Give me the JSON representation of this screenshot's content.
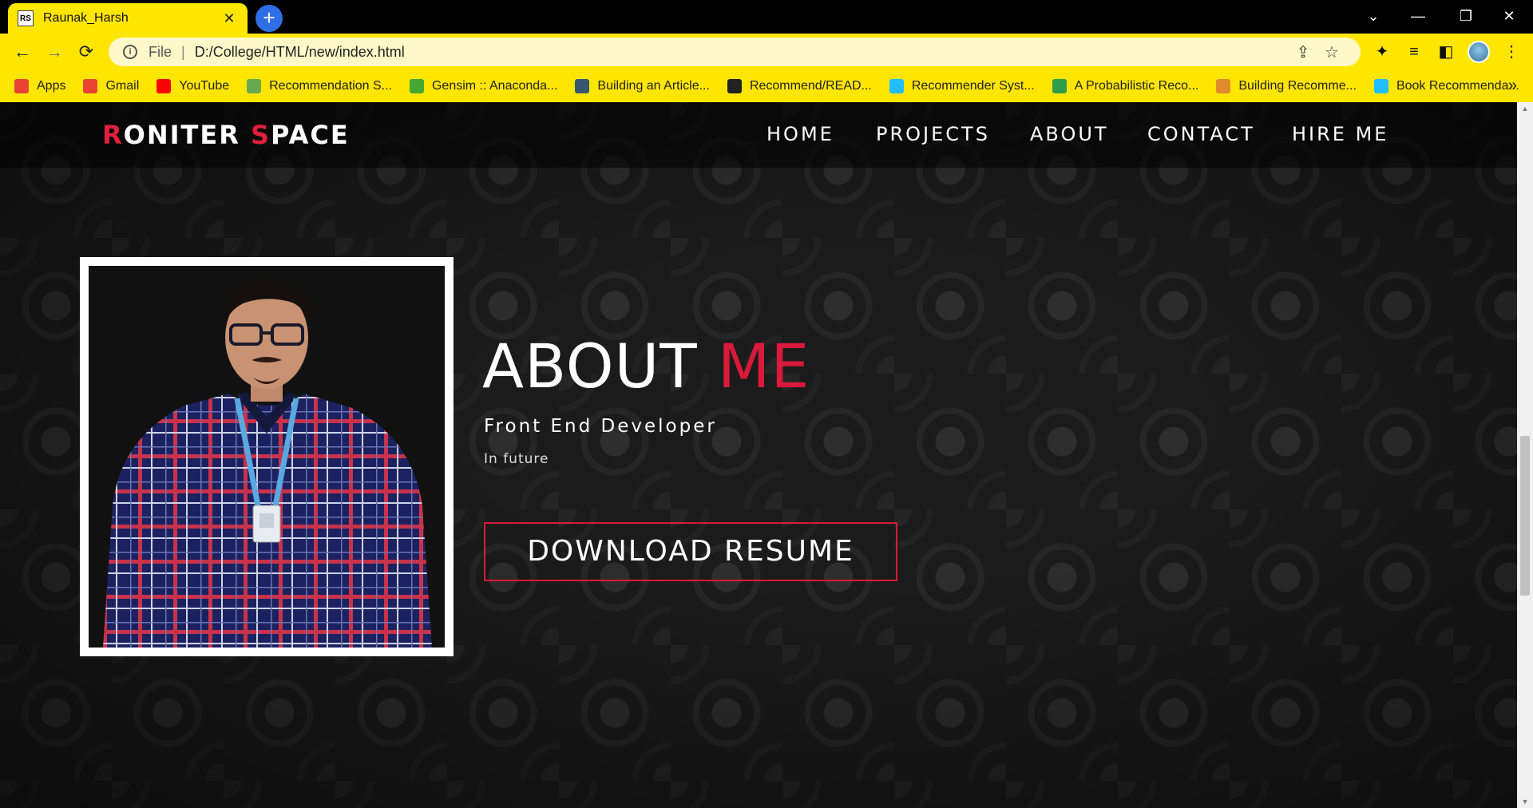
{
  "browser": {
    "tab": {
      "favicon_text": "RS",
      "title": "Raunak_Harsh",
      "close_glyph": "✕"
    },
    "new_tab_glyph": "+",
    "window_controls": {
      "list": "⌄",
      "minimize": "—",
      "restore": "❐",
      "close": "✕"
    },
    "nav": {
      "back": "←",
      "forward": "→",
      "reload": "⟳"
    },
    "address": {
      "info_glyph": "i",
      "scheme": "File",
      "url": "D:/College/HTML/new/index.html"
    },
    "bookmarks": [
      {
        "label": "Apps",
        "icon": "apps-grid-icon",
        "color": "#e94235"
      },
      {
        "label": "Gmail",
        "icon": "gmail-icon",
        "color": "#ea4335"
      },
      {
        "label": "YouTube",
        "icon": "youtube-icon",
        "color": "#ff0000"
      },
      {
        "label": "Recommendation S...",
        "icon": "site-icon",
        "color": "#6aa84f"
      },
      {
        "label": "Gensim :: Anaconda...",
        "icon": "anaconda-icon",
        "color": "#44a833"
      },
      {
        "label": "Building an Article...",
        "icon": "tds-icon",
        "color": "#355870"
      },
      {
        "label": "Recommend/READ...",
        "icon": "github-icon",
        "color": "#222222"
      },
      {
        "label": "Recommender Syst...",
        "icon": "kaggle-icon",
        "color": "#20beff"
      },
      {
        "label": "A Probabilistic Reco...",
        "icon": "site-icon",
        "color": "#2e9d4b"
      },
      {
        "label": "Building Recomme...",
        "icon": "site-icon",
        "color": "#e08a2c"
      },
      {
        "label": "Book Recommenda...",
        "icon": "kaggle-icon",
        "color": "#20beff"
      }
    ],
    "bookmarks_more": "»"
  },
  "site": {
    "logo": {
      "first_initial": "R",
      "first_rest": "ONITER ",
      "second_initial": "S",
      "second_rest": "PACE"
    },
    "nav": [
      "HOME",
      "PROJECTS",
      "ABOUT",
      "CONTACT",
      "HIRE ME"
    ],
    "about": {
      "title_white": "ABOUT ",
      "title_red": "ME",
      "subtitle": "Front End Developer",
      "note": "In future",
      "button": "DOWNLOAD RESUME"
    },
    "colors": {
      "accent": "#d91a3a",
      "chrome": "#ffe600"
    }
  }
}
